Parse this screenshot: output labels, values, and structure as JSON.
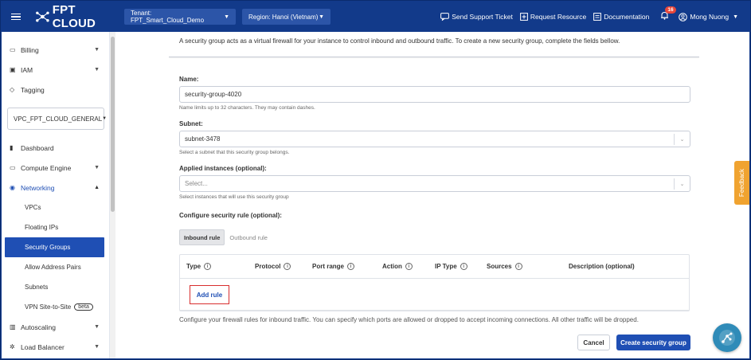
{
  "topbar": {
    "logo_text": "FPT CLOUD",
    "tenant": "Tenant: FPT_Smart_Cloud_Demo",
    "region": "Region: Hanoi (Vietnam)",
    "links": [
      "Send Support Ticket",
      "Request Resource",
      "Documentation"
    ],
    "notification_count": "16",
    "user_name": "Mong Nuong"
  },
  "sidebar": {
    "items_top": [
      {
        "label": "Billing",
        "icon": "billing-icon",
        "expandable": true
      },
      {
        "label": "IAM",
        "icon": "iam-icon",
        "expandable": true
      },
      {
        "label": "Tagging",
        "icon": "tag-icon",
        "expandable": false
      }
    ],
    "vpc_select": "VPC_FPT_CLOUD_GENERAL",
    "items_main": [
      {
        "label": "Dashboard",
        "icon": "chart-icon",
        "expandable": false
      },
      {
        "label": "Compute Engine",
        "icon": "monitor-icon",
        "expandable": true
      },
      {
        "label": "Networking",
        "icon": "network-icon",
        "expandable": true
      }
    ],
    "networking_children": [
      "VPCs",
      "Floating IPs",
      "Security Groups",
      "Allow Address Pairs",
      "Subnets",
      "VPN Site-to-Site"
    ],
    "active_child": "Security Groups",
    "beta_label": "beta",
    "items_bottom": [
      {
        "label": "Autoscaling",
        "icon": "autoscaling-icon",
        "expandable": true
      },
      {
        "label": "Load Balancer",
        "icon": "load-balancer-icon",
        "expandable": true
      }
    ]
  },
  "form": {
    "intro": "A security group acts as a virtual firewall for your instance to control inbound and outbound traffic. To create a new security group, complete the fields bellow.",
    "name_label": "Name:",
    "name_value": "security-group-4020",
    "name_hint": "Name limits up to 32 characters. They may contain dashes.",
    "subnet_label": "Subnet:",
    "subnet_value": "subnet-3478",
    "subnet_hint": "Select a subnet that this security group belongs.",
    "instances_label": "Applied instances (optional):",
    "instances_placeholder": "Select...",
    "instances_hint": "Select instances that will use this security group",
    "rule_label": "Configure security rule (optional):",
    "tab_inbound": "Inbound rule",
    "tab_outbound": "Outbound rule",
    "columns": [
      "Type",
      "Protocol",
      "Port range",
      "Action",
      "IP Type",
      "Sources",
      "Description (optional)"
    ],
    "add_rule": "Add rule",
    "footer_note": "Configure your firewall rules for inbound traffic. You can specify which ports are allowed or dropped to accept incoming connections. All other traffic will be dropped.",
    "cancel": "Cancel",
    "create": "Create security group"
  },
  "feedback_label": "Feedback",
  "colors": {
    "brand": "#123a8a",
    "primary": "#1f4fb4",
    "feedback": "#f0a330",
    "highlight": "#d82e2e"
  }
}
